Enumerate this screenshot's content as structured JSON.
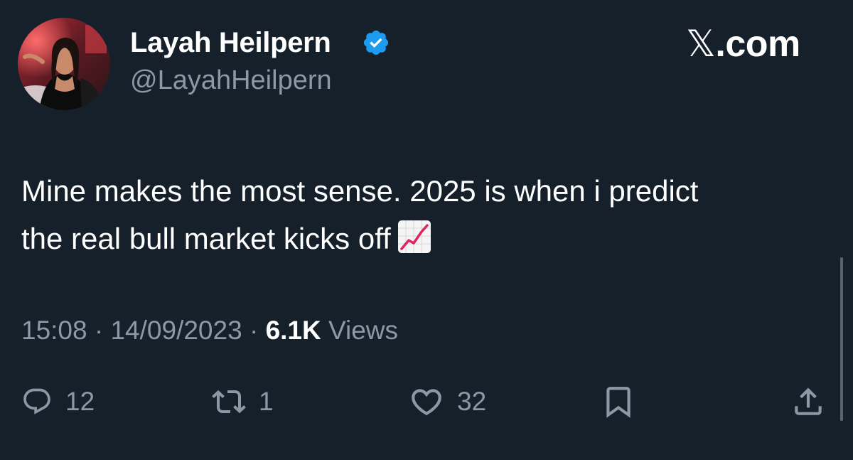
{
  "author": {
    "display_name": "Layah Heilpern",
    "handle": "@LayahHeilpern",
    "verified": true,
    "avatar_icon": "profile-photo"
  },
  "brand": {
    "name": "𝕏.com",
    "x_glyph": "𝕏",
    "domain": ".com"
  },
  "tweet": {
    "text": "Mine makes the most sense. 2025 is when i predict the real bull market kicks off",
    "emoji": "chart-increasing-emoji"
  },
  "meta": {
    "time": "15:08",
    "separator": "·",
    "date": "14/09/2023",
    "views_count": "6.1K",
    "views_label": "Views"
  },
  "actions": {
    "replies": "12",
    "retweets": "1",
    "likes": "32"
  },
  "colors": {
    "background": "#15202b",
    "text_primary": "#ffffff",
    "text_secondary": "#8b98a5",
    "verified_badge": "#1d9bf0",
    "chart_line": "#e0245e"
  }
}
